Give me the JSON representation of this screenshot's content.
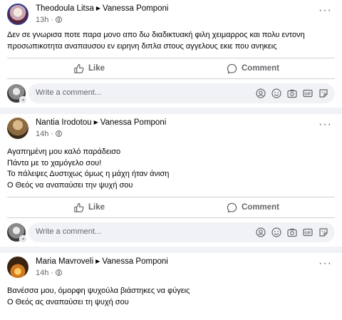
{
  "posts": [
    {
      "author": "Theodoula Litsa",
      "recipient": "Vanessa Pomponi",
      "time": "13h",
      "lines": [
        "Δεν σε γνωρισα ποτε παρα μονο απο δω διαδικτυακή φιλη χειμαρρος και πολυ εντονη",
        "προσωπικοτητα αναπαυσου εν ειρηνη διπλα στους αγγελους εκιε που ανηκεις"
      ]
    },
    {
      "author": "Nantia Irodotou",
      "recipient": "Vanessa Pomponi",
      "time": "14h",
      "lines": [
        "Αγαπημένη μου καλό παράδεισο",
        "Πάντα με το χαμόγελο σου!",
        "Το πάλεψες Δυστιχως όμως η μάχη ήταν άνιση",
        "Ο Θεός να αναπαύσει την ψυχή σου"
      ]
    },
    {
      "author": "Maria Mavroveli",
      "recipient": "Vanessa Pomponi",
      "time": "14h",
      "lines": [
        "Βανέσσα μου, όμορφη ψυχούλα βιάστηκες να φύγεις",
        "Ο Θεός ας αναπαύσει τη ψυχή σου"
      ]
    }
  ],
  "actions": {
    "like": "Like",
    "comment": "Comment"
  },
  "comment_placeholder": "Write a comment...",
  "icons": {
    "comment_box": [
      "avatar-sticker-icon",
      "emoji-icon",
      "camera-icon",
      "gif-icon",
      "sticker-icon"
    ],
    "header": "more-options-icon",
    "privacy": "globe-icon"
  },
  "colors": {
    "background": "#f0f2f5",
    "card": "#ffffff",
    "secondary_text": "#65676b"
  }
}
